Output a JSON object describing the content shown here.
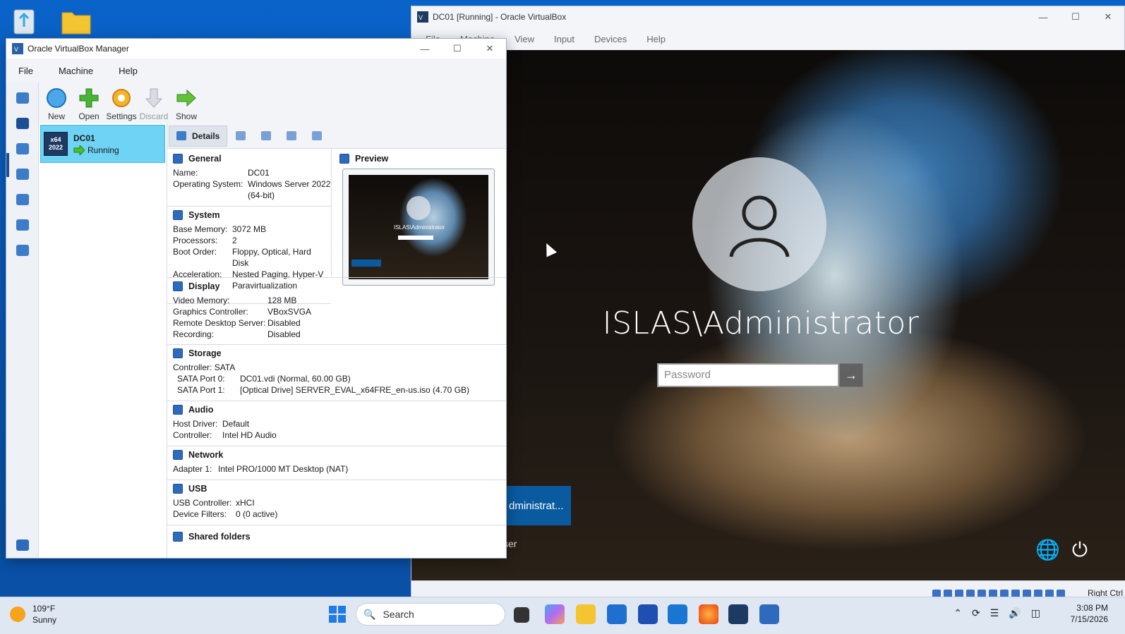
{
  "desktop": {
    "recycle_icon": "recycle-bin-icon",
    "folder_icon": "folder-icon"
  },
  "vm_window": {
    "title": "DC01 [Running] - Oracle VirtualBox",
    "menu": [
      "File",
      "Machine",
      "View",
      "Input",
      "Devices",
      "Help"
    ],
    "login": {
      "user": "ISLAS\\Administrator",
      "password_placeholder": "Password",
      "tile_label": "dministrat...",
      "other_user": "ser"
    },
    "status_right": "Right Ctrl"
  },
  "manager": {
    "title": "Oracle VirtualBox Manager",
    "menu": [
      "File",
      "Machine",
      "Help"
    ],
    "toolbar": [
      "New",
      "Open",
      "Settings",
      "Discard",
      "Show"
    ],
    "vm": {
      "name": "DC01",
      "state": "Running",
      "os_badge_top": "x64",
      "os_badge_bottom": "2022"
    },
    "tabs": {
      "details": "Details"
    },
    "general": {
      "title": "General",
      "rows": [
        [
          "Name:",
          "DC01"
        ],
        [
          "Operating System:",
          "Windows Server 2022"
        ],
        [
          "",
          "(64-bit)"
        ]
      ]
    },
    "system": {
      "title": "System",
      "rows": [
        [
          "Base Memory:",
          "3072 MB"
        ],
        [
          "Processors:",
          "2"
        ],
        [
          "Boot Order:",
          "Floppy, Optical, Hard"
        ],
        [
          "",
          "Disk"
        ],
        [
          "Acceleration:",
          "Nested Paging, Hyper-V"
        ],
        [
          "",
          "Paravirtualization"
        ]
      ]
    },
    "preview": {
      "title": "Preview",
      "user": "ISLAS\\Administrator"
    },
    "display": {
      "title": "Display",
      "rows": [
        [
          "Video Memory:",
          "128 MB"
        ],
        [
          "Graphics Controller:",
          "VBoxSVGA"
        ],
        [
          "Remote Desktop Server:",
          "Disabled"
        ],
        [
          "Recording:",
          "Disabled"
        ]
      ]
    },
    "storage": {
      "title": "Storage",
      "controller": "Controller: SATA",
      "rows": [
        [
          "SATA Port 0:",
          "DC01.vdi (Normal, 60.00 GB)"
        ],
        [
          "SATA Port 1:",
          "[Optical Drive] SERVER_EVAL_x64FRE_en-us.iso (4.70 GB)"
        ]
      ]
    },
    "audio": {
      "title": "Audio",
      "rows": [
        [
          "Host Driver:",
          "Default"
        ],
        [
          "Controller:",
          "Intel HD Audio"
        ]
      ]
    },
    "network": {
      "title": "Network",
      "rows": [
        [
          "Adapter 1:",
          "Intel PRO/1000 MT Desktop (NAT)"
        ]
      ]
    },
    "usb": {
      "title": "USB",
      "rows": [
        [
          "USB Controller:",
          "xHCI"
        ],
        [
          "Device Filters:",
          "0 (0 active)"
        ]
      ]
    },
    "shared_folders_partial": "Shared folders"
  },
  "taskbar": {
    "weather_temp": "109°F",
    "weather_desc": "Sunny",
    "search": "Search",
    "time": "3:08 PM",
    "date": "7/15/2026"
  }
}
